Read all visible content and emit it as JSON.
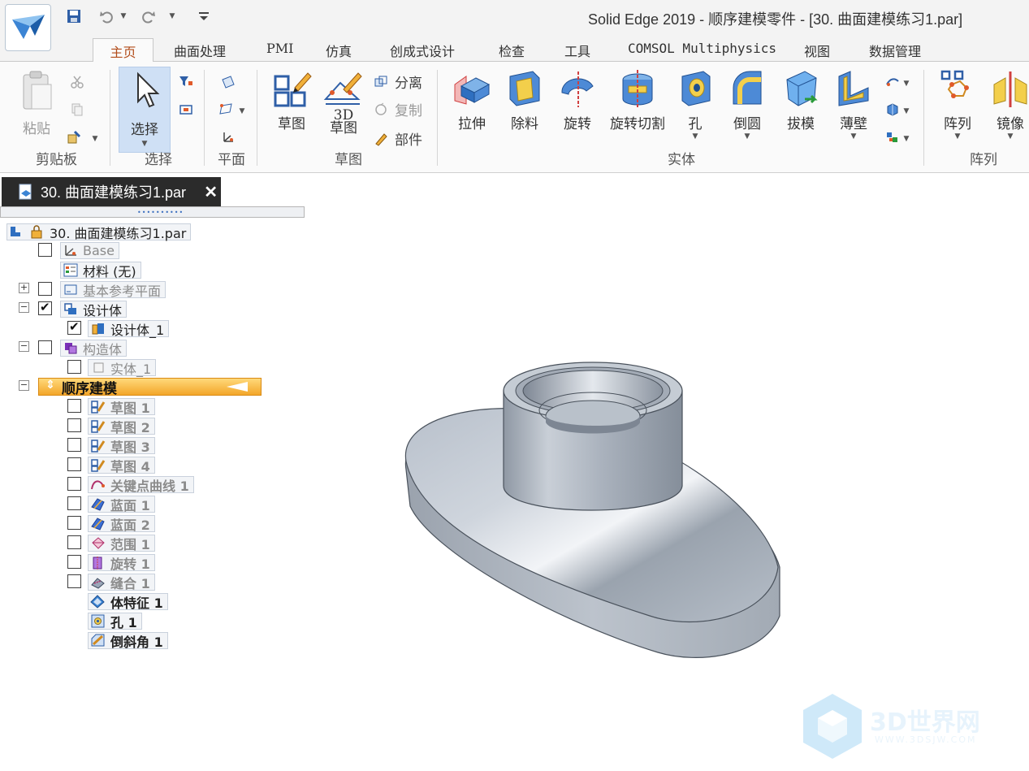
{
  "window": {
    "title": "Solid Edge 2019 - 顺序建模零件 - [30. 曲面建模练习1.par]"
  },
  "quick_access": {
    "icons": [
      "save-icon",
      "undo-icon",
      "redo-icon",
      "customize-icon"
    ]
  },
  "tabs": [
    {
      "label": "主页",
      "active": true
    },
    {
      "label": "曲面处理"
    },
    {
      "label": "PMI"
    },
    {
      "label": "仿真"
    },
    {
      "label": "创成式设计"
    },
    {
      "label": "检查"
    },
    {
      "label": "工具"
    },
    {
      "label": "COMSOL Multiphysics"
    },
    {
      "label": "视图"
    },
    {
      "label": "数据管理"
    }
  ],
  "ribbon": {
    "clipboard": {
      "paste": "粘贴",
      "group": "剪贴板"
    },
    "select": {
      "select": "选择",
      "group": "选择"
    },
    "plane": {
      "group": "平面"
    },
    "sketch": {
      "sketch": "草图",
      "sketch3d_line1": "3D",
      "sketch3d_line2": "草图",
      "separate": "分离",
      "copy": "复制",
      "part": "部件",
      "group": "草图"
    },
    "solid": {
      "extrude": "拉伸",
      "cutout": "除料",
      "revolve": "旋转",
      "revolved_cut": "旋转切割",
      "hole": "孔",
      "round": "倒圆",
      "draft": "拔模",
      "thin_wall": "薄壁",
      "group": "实体"
    },
    "pattern": {
      "pattern": "阵列",
      "mirror": "镜像",
      "group": "阵列"
    }
  },
  "document_tab": {
    "label": "30. 曲面建模练习1.par"
  },
  "tree": {
    "root": "30. 曲面建模练习1.par",
    "base": "Base",
    "material": "材料 (无)",
    "ref_planes": "基本参考平面",
    "design_bodies": "设计体",
    "design_body_1": "设计体_1",
    "construction": "构造体",
    "solid_1": "实体_1",
    "sequential": "顺序建模",
    "features": [
      {
        "label": "草图 1",
        "icon": "sketch-icon"
      },
      {
        "label": "草图 2",
        "icon": "sketch-icon"
      },
      {
        "label": "草图 3",
        "icon": "sketch-icon"
      },
      {
        "label": "草图 4",
        "icon": "sketch-icon"
      },
      {
        "label": "关键点曲线 1",
        "icon": "keypoint-curve-icon"
      },
      {
        "label": "蓝面 1",
        "icon": "bluesurf-icon"
      },
      {
        "label": "蓝面 2",
        "icon": "bluesurf-icon"
      },
      {
        "label": "范围 1",
        "icon": "bounded-icon"
      },
      {
        "label": "旋转 1",
        "icon": "revolve-surface-icon"
      },
      {
        "label": "缝合 1",
        "icon": "stitch-icon"
      }
    ],
    "solid_features": [
      {
        "label": "体特征 1",
        "icon": "body-feature-icon"
      },
      {
        "label": "孔 1",
        "icon": "hole-icon"
      },
      {
        "label": "倒斜角 1",
        "icon": "chamfer-icon"
      }
    ]
  },
  "watermark": {
    "text": "3D世界网",
    "sub": "WWW.3DSJW.COM"
  },
  "colors": {
    "accent": "#b24c1a",
    "selection": "#cfe0f5",
    "sequential_bar": "#f3a62a",
    "model": "#b5bdc7"
  }
}
